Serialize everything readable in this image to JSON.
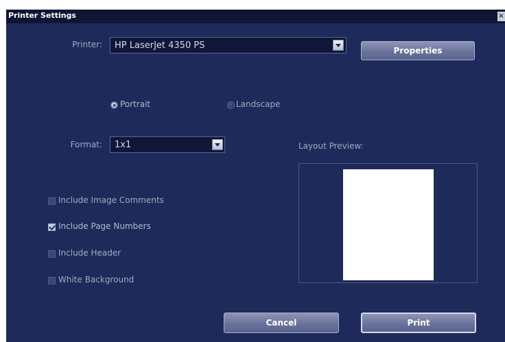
{
  "dialog": {
    "title": "Printer Settings",
    "close_symbol": "×"
  },
  "printer": {
    "label": "Printer:",
    "value": "HP LaserJet 4350 PS",
    "properties_label": "Properties"
  },
  "orientation": {
    "portrait_label": "Portrait",
    "landscape_label": "Landscape",
    "selected": "Portrait"
  },
  "format": {
    "label": "Format:",
    "value": "1x1"
  },
  "preview": {
    "label": "Layout Preview:"
  },
  "options": [
    {
      "label": "Include Image Comments",
      "checked": false
    },
    {
      "label": "Include Page Numbers",
      "checked": true
    },
    {
      "label": "Include Header",
      "checked": false
    },
    {
      "label": "White Background",
      "checked": false
    }
  ],
  "buttons": {
    "cancel_label": "Cancel",
    "print_label": "Print"
  },
  "colors": {
    "dialog_bg": "#1d2a5a",
    "titlebar_bg": "#0f1534",
    "label_text": "#a3aac4"
  }
}
